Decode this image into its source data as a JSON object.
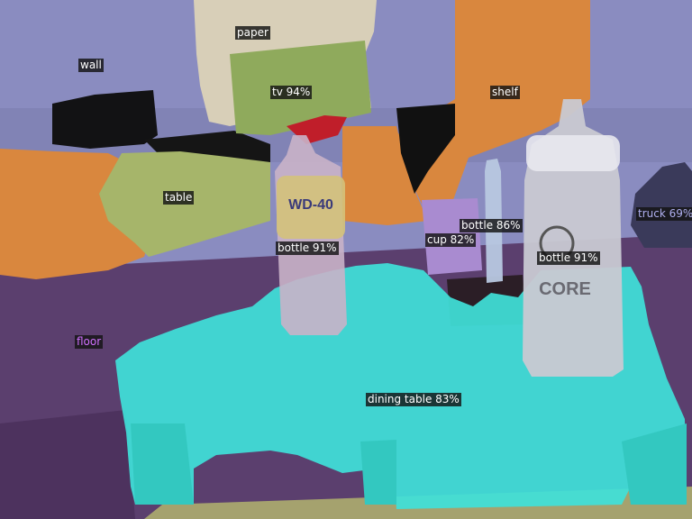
{
  "image": {
    "description_free": true
  },
  "colors": {
    "wall": "#8a8cc0",
    "floor": "#5b3f6e",
    "shelf": "#d9873e",
    "table": "#a6b56a",
    "tv": "#8faa5c",
    "paper": "#d8cfb8",
    "dining_table": "#3fe0d8",
    "bottle": "#c9c9d2",
    "cup": "#a98bd0",
    "truck": "#3a3a5a"
  },
  "labels": {
    "paper": "paper",
    "wall": "wall",
    "tv": "tv 94%",
    "shelf": "shelf",
    "table": "table",
    "truck": "truck 69%",
    "bottle_center": "bottle 86%",
    "cup": "cup 82%",
    "bottle_left": "bottle 91%",
    "bottle_right": "bottle 91%",
    "floor": "floor",
    "dining_table": "dining table 83%"
  },
  "label_colors": {
    "paper": "#ffffff",
    "wall": "#ffffff",
    "tv": "#ffffff",
    "shelf": "#ffffff",
    "table": "#ffffff",
    "truck": "#b0b0f0",
    "bottle_center": "#ffffff",
    "cup": "#ffffff",
    "bottle_left": "#ffffff",
    "bottle_right": "#ffffff",
    "floor": "#d070ff",
    "dining_table": "#ffffff"
  },
  "bottle_texts": {
    "brand_left": "WD-40",
    "brand_right": "CORE"
  }
}
